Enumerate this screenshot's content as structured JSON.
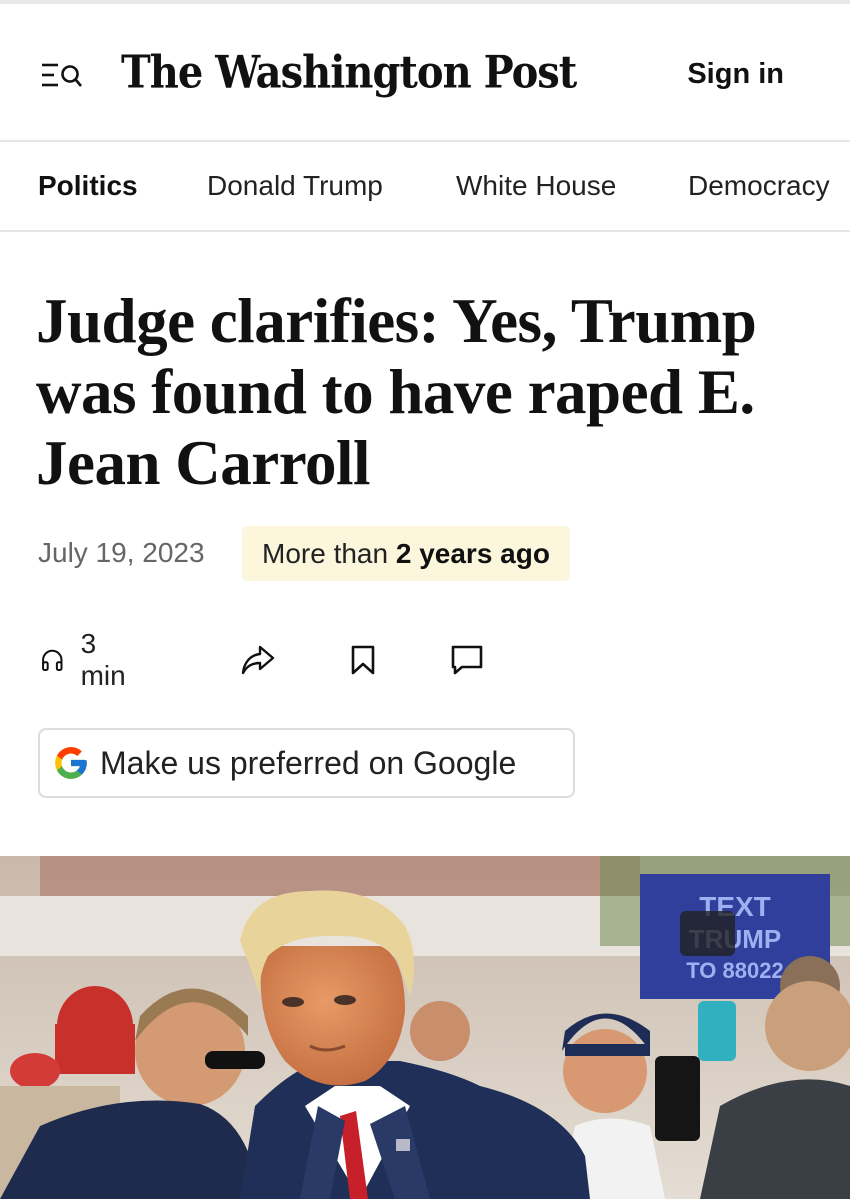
{
  "header": {
    "logo_text": "The Washington Post",
    "sign_in_label": "Sign in",
    "menu_icon": "menu-search-icon"
  },
  "nav": {
    "items": [
      {
        "label": "Politics",
        "active": true
      },
      {
        "label": "Donald Trump",
        "active": false
      },
      {
        "label": "White House",
        "active": false
      },
      {
        "label": "Democracy",
        "active": false
      }
    ]
  },
  "article": {
    "headline": "Judge clarifies: Yes, Trump was found to have raped E. Jean Carroll",
    "date": "July 19, 2023",
    "age_prefix": "More than ",
    "age_bold": "2 years ago",
    "listen_time": "3 min",
    "action_icons": [
      "headphones-icon",
      "share-icon",
      "bookmark-icon",
      "comment-icon"
    ],
    "google_button_label": "Make us preferred on Google"
  },
  "photo": {
    "sign_text_1": "TEXT",
    "sign_text_2": "TRUMP",
    "sign_text_3": "TO 88022"
  },
  "colors": {
    "badge_bg": "#fbf6dc",
    "suit_blue": "#1f2f57",
    "tie_red": "#c8202a",
    "sign_blue": "#2f3f9b"
  }
}
